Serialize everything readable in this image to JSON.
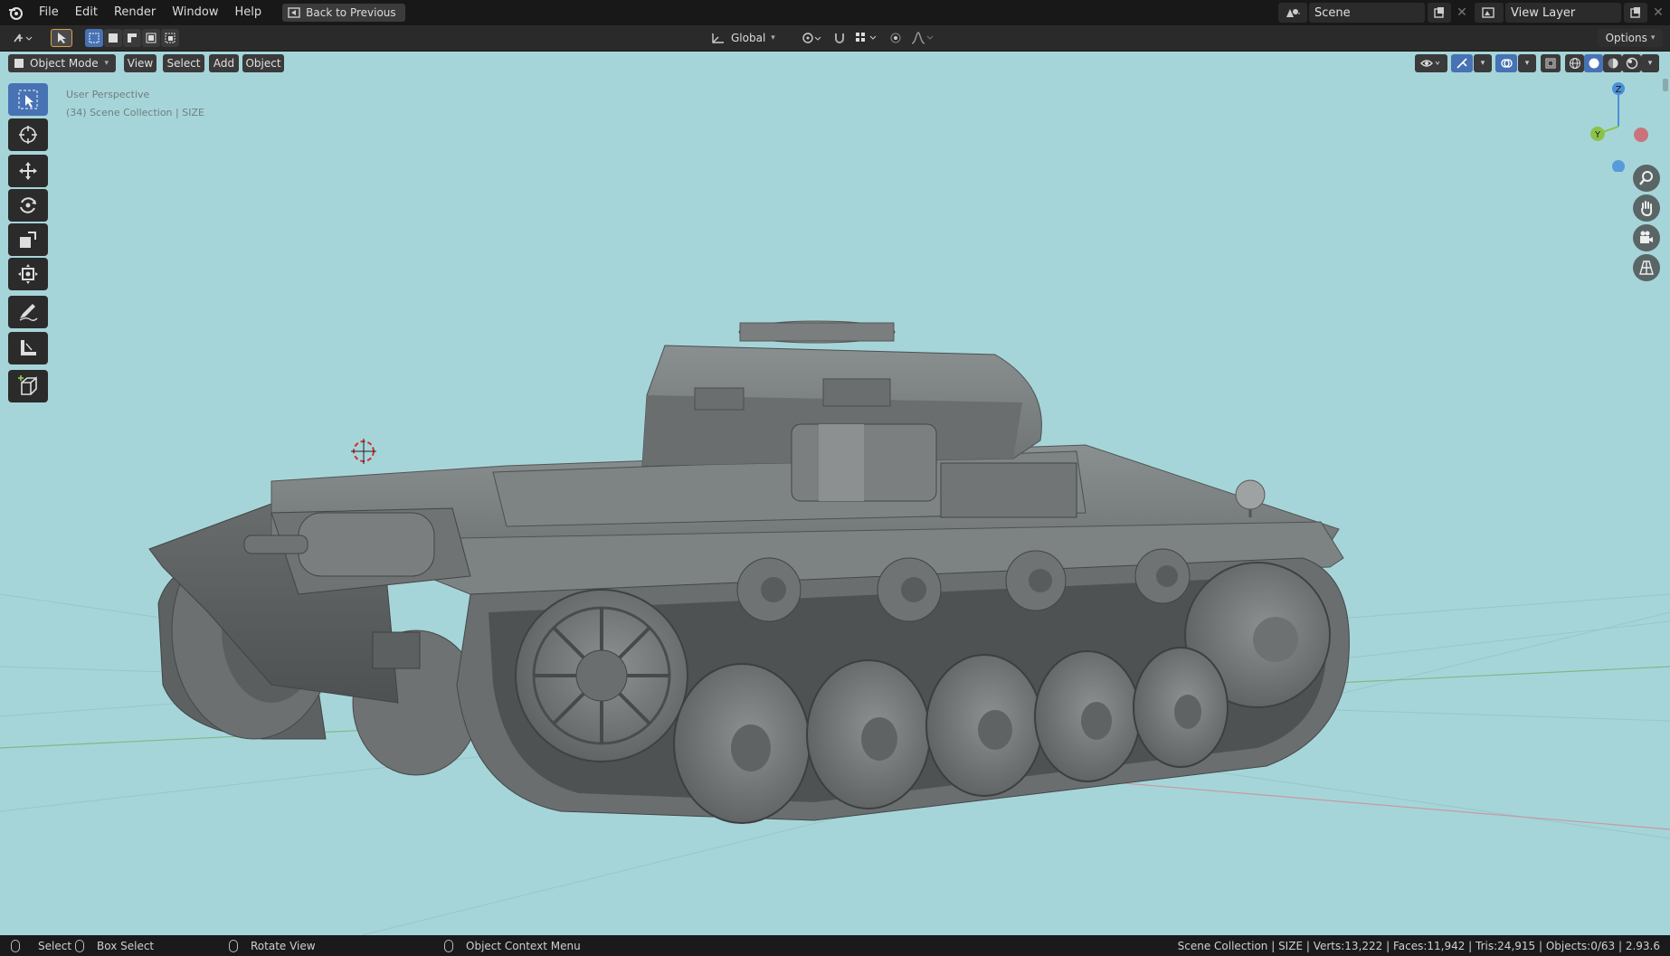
{
  "menubar": {
    "items": [
      "File",
      "Edit",
      "Render",
      "Window",
      "Help"
    ],
    "back_label": "Back to Previous",
    "scene_label": "Scene",
    "view_layer_label": "View Layer"
  },
  "toolbar": {
    "orientation": "Global",
    "options_label": "Options"
  },
  "viewport": {
    "mode_label": "Object Mode",
    "header_menus": [
      "View",
      "Select",
      "Add",
      "Object"
    ],
    "perspective_label": "User Perspective",
    "collection_label": "(34) Scene Collection | SIZE",
    "gizmo": {
      "z_label": "Z",
      "y_label": "Y"
    },
    "background_color": "#a6d5d9"
  },
  "statusbar": {
    "select_label": "Select",
    "box_select_label": "Box Select",
    "rotate_label": "Rotate View",
    "context_menu_label": "Object Context Menu",
    "stats": "Scene Collection | SIZE | Verts:13,222 | Faces:11,942 | Tris:24,915 | Objects:0/63 | 2.93.6"
  },
  "colors": {
    "accent": "#4772b3",
    "axis_x": "#d0616b",
    "axis_y": "#8bc34a",
    "axis_z": "#4a90d9"
  }
}
